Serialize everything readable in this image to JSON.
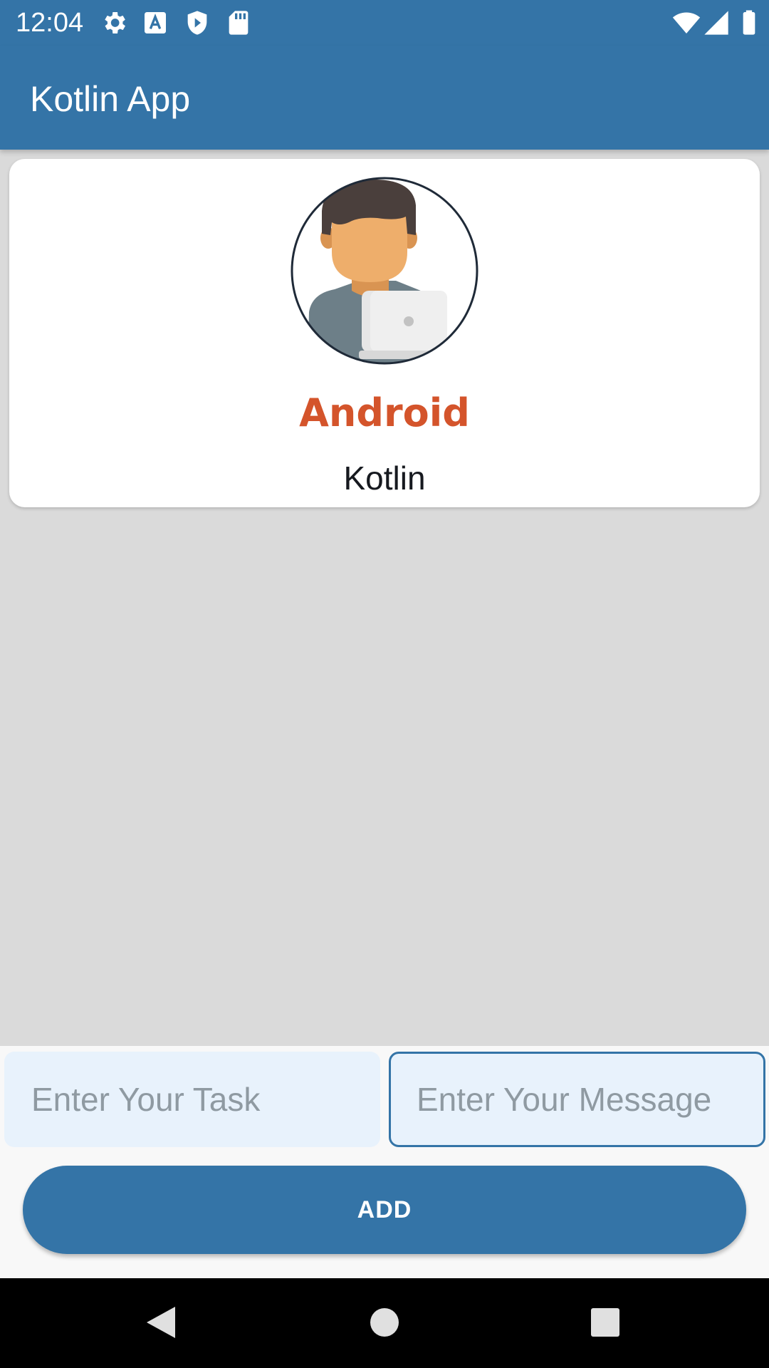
{
  "status_bar": {
    "time": "12:04",
    "left_icons": [
      "settings-icon",
      "text-a-icon",
      "shield-icon",
      "sd-card-icon"
    ],
    "right_icons": [
      "wifi-icon",
      "cellular-signal-icon",
      "battery-icon"
    ]
  },
  "app_bar": {
    "title": "Kotlin App"
  },
  "profile_card": {
    "avatar_icon": "person-with-laptop-avatar",
    "name": "Android",
    "subtitle": "Kotlin"
  },
  "form": {
    "task_placeholder": "Enter Your Task",
    "task_value": "",
    "message_placeholder": "Enter Your Message",
    "message_value": "",
    "add_label": "ADD"
  },
  "nav_bar": {
    "buttons": [
      "back-icon",
      "home-icon",
      "recents-icon"
    ]
  },
  "colors": {
    "primary": "#3474a7",
    "name_accent": "#d4542b",
    "background": "#dadada",
    "field_fill": "#e8f2fc"
  }
}
